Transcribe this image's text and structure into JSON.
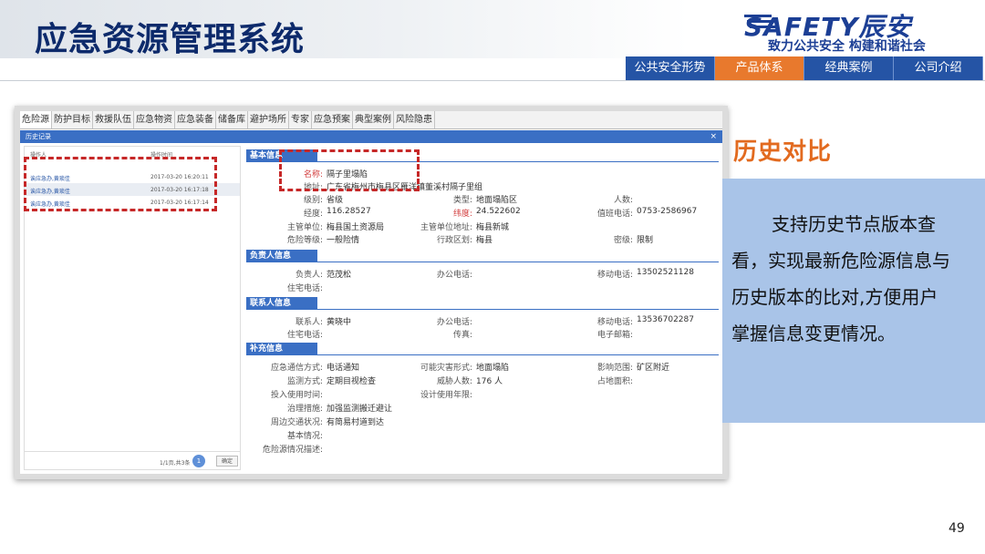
{
  "header": {
    "title": "应急资源管理系统",
    "logo_text": "SAFETY辰安",
    "logo_slogan": "致力公共安全 构建和谐社会",
    "nav": [
      {
        "label": "公共安全形势",
        "active": false
      },
      {
        "label": "产品体系",
        "active": true
      },
      {
        "label": "经典案例",
        "active": false
      },
      {
        "label": "公司介绍",
        "active": false
      }
    ],
    "colors": {
      "title": "#0d2a6b",
      "nav_bg": "#2554a5",
      "nav_active": "#e8792d"
    }
  },
  "screenshot": {
    "tabs": [
      {
        "label": "危险源",
        "active": true
      },
      {
        "label": "防护目标"
      },
      {
        "label": "救援队伍"
      },
      {
        "label": "应急物资"
      },
      {
        "label": "应急装备"
      },
      {
        "label": "储备库"
      },
      {
        "label": "避护场所"
      },
      {
        "label": "专家"
      },
      {
        "label": "应急预案"
      },
      {
        "label": "典型案例"
      },
      {
        "label": "风险隐患"
      }
    ],
    "subbar_label": "历史记录",
    "close_glyph": "×",
    "history": {
      "columns": [
        "操作人",
        "操作时间"
      ],
      "rows": [
        {
          "user": "诶应急办,黄琐佳",
          "time": "2017-03-20 16:20:11"
        },
        {
          "user": "诶应急办,黄琐佳",
          "time": "2017-03-20 16:17:18"
        },
        {
          "user": "诶应急办,黄琐佳",
          "time": "2017-03-20 16:17:14"
        }
      ],
      "pager_text": "1/1页,共3条",
      "page": "1",
      "go_label": "确定"
    },
    "sections": {
      "basic": "基本信息",
      "owner": "负责人信息",
      "contact": "联系人信息",
      "extra": "补充信息"
    },
    "basic": {
      "name_label": "名称:",
      "name": "隔子里塌陷",
      "address_label": "地址:",
      "address": "广东省梅州市梅县区雁洋镇董溪村隔子里组",
      "level_label": "级别:",
      "level": "省级",
      "category_label": "类型:",
      "category": "地面塌陷区",
      "people_label": "人数:",
      "people": "",
      "lon_label": "经度:",
      "lon": "116.28527",
      "lat_label": "纬度:",
      "lat": "24.522602",
      "duty_label": "值班电话:",
      "duty": "0753-2586967",
      "dept_label": "主管单位:",
      "dept": "梅县国土资源局",
      "dept_addr_label": "主管单位地址:",
      "dept_addr": "梅县新城",
      "risk_label": "危险等级:",
      "risk": "一般险情",
      "region_label": "行政区划:",
      "region": "梅县",
      "secret_label": "密级:",
      "secret": "限制"
    },
    "owner": {
      "name_label": "负责人:",
      "name": "范茂松",
      "office_label": "办公电话:",
      "office": "",
      "mobile_label": "移动电话:",
      "mobile": "13502521128",
      "home_label": "住宅电话:",
      "home": ""
    },
    "contact": {
      "name_label": "联系人:",
      "name": "黄晓中",
      "office_label": "办公电话:",
      "office": "",
      "mobile_label": "移动电话:",
      "mobile": "13536702287",
      "home_label": "住宅电话:",
      "home": "",
      "fax_label": "传真:",
      "fax": "",
      "email_label": "电子邮箱:",
      "email": ""
    },
    "extra": {
      "comm_label": "应急通信方式:",
      "comm": "电话通知",
      "disaster_label": "可能灾害形式:",
      "disaster": "地面塌陷",
      "range_label": "影响范围:",
      "range": "矿区附近",
      "monitor_label": "监测方式:",
      "monitor": "定期目视检查",
      "threat_label": "威胁人数:",
      "threat": "176 人",
      "area_label": "占地面积:",
      "area": "",
      "start_label": "投入使用时间:",
      "start": "",
      "life_label": "设计使用年限:",
      "life": "",
      "measure_label": "治理措施:",
      "measure": "加强监测搬迁避让",
      "traffic_label": "周边交通状况:",
      "traffic": "有简易村道到达",
      "basic_label": "基本情况:",
      "basic": "",
      "desc_label": "危险源情况描述:",
      "desc": ""
    }
  },
  "right_panel": {
    "title": "历史对比",
    "text": "支持历史节点版本查看，实现最新危险源信息与历史版本的比对,方便用户掌握信息变更情况。",
    "title_color": "#e26a1f",
    "box_color": "#a9c4e8"
  },
  "page_number": "49"
}
